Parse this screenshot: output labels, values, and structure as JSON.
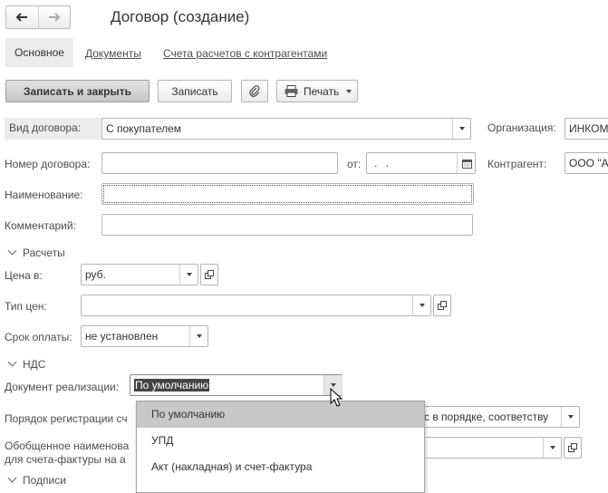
{
  "window": {
    "title": "Договор (создание)"
  },
  "nav": {
    "back": "🡐",
    "forward": "🡒"
  },
  "tabs": [
    {
      "label": "Основное"
    },
    {
      "label": "Документы"
    },
    {
      "label": "Счета расчетов с контрагентами"
    }
  ],
  "toolbar": {
    "save_close": "Записать и закрыть",
    "save": "Записать",
    "print": "Печать"
  },
  "form": {
    "contract_type": {
      "label": "Вид договора:",
      "value": "С покупателем"
    },
    "organization": {
      "label": "Организация:",
      "value": "ИНКОМ"
    },
    "contract_number": {
      "label": "Номер договора:",
      "value": ""
    },
    "date": {
      "label": "от:",
      "value": " .  ."
    },
    "counterparty": {
      "label": "Контрагент:",
      "value": "ООО \"А"
    },
    "name": {
      "label": "Наименование:",
      "value": ""
    },
    "comment": {
      "label": "Комментарий:",
      "value": ""
    }
  },
  "settlements": {
    "title": "Расчеты",
    "price_in": {
      "label": "Цена в:",
      "value": "руб."
    },
    "price_type": {
      "label": "Тип цен:",
      "value": ""
    },
    "payment_term": {
      "label": "Срок оплаты:",
      "value": "не установлен"
    }
  },
  "vat": {
    "title": "НДС",
    "sales_doc": {
      "label": "Документ реализации:",
      "value": "По умолчанию"
    },
    "registration_order": {
      "label": "Порядок регистрации сч",
      "value": "с в порядке, соответству"
    },
    "generic_name": {
      "label_line1": "Обобщенное наименова",
      "label_line2": "для счета-фактуры на а"
    }
  },
  "signatures": {
    "title": "Подписи"
  },
  "dropdown": {
    "items": [
      "По умолчанию",
      "УПД",
      "Акт (накладная) и счет-фактура"
    ],
    "selected_index": 0
  }
}
